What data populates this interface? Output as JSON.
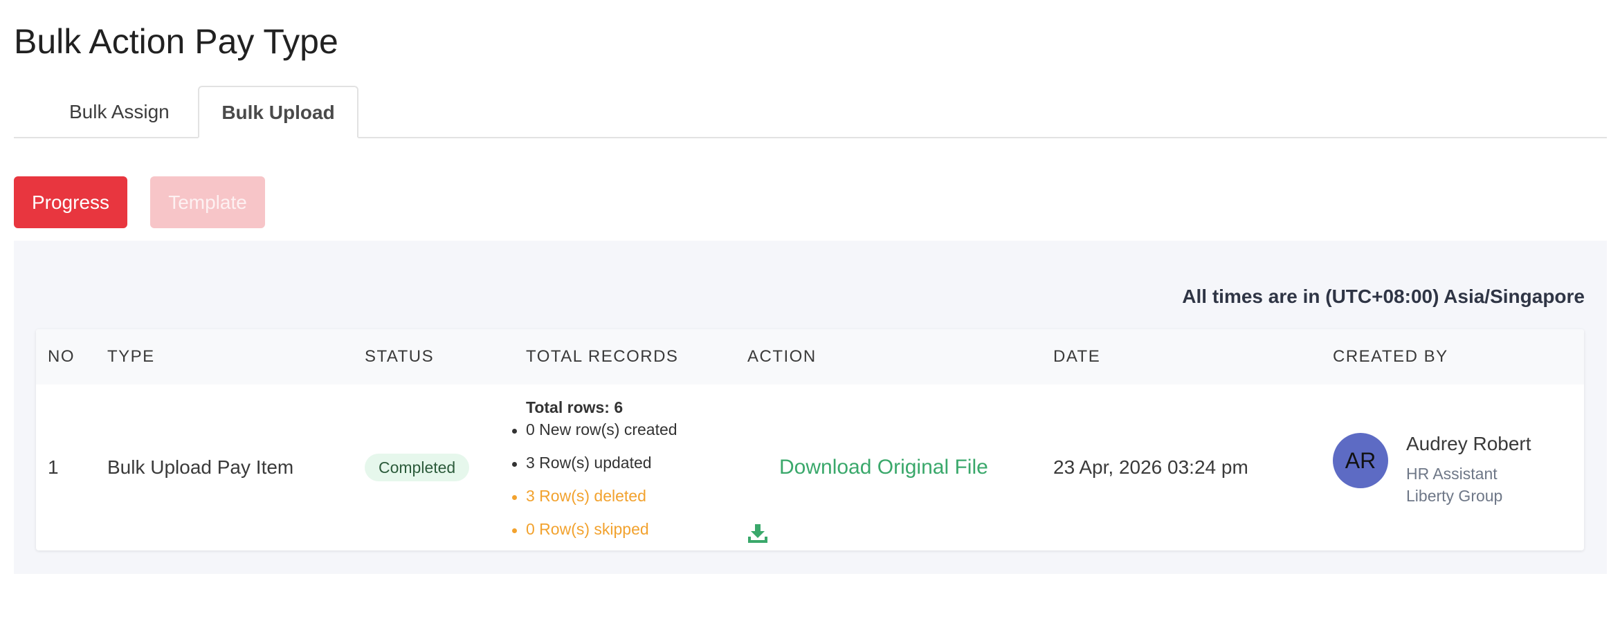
{
  "page": {
    "title": "Bulk Action Pay Type"
  },
  "tabs": [
    {
      "label": "Bulk Assign",
      "active": false
    },
    {
      "label": "Bulk Upload",
      "active": true
    }
  ],
  "toolbar": {
    "progress_label": "Progress",
    "template_label": "Template",
    "progress_color": "#e8363f",
    "template_color": "#f7c5c8"
  },
  "panel": {
    "timezone_note": "All times are in (UTC+08:00) Asia/Singapore"
  },
  "table": {
    "headers": {
      "no": "NO",
      "type": "TYPE",
      "status": "STATUS",
      "total_records": "TOTAL RECORDS",
      "action": "ACTION",
      "date": "DATE",
      "created_by": "CREATED BY"
    },
    "rows": [
      {
        "no": "1",
        "type": "Bulk Upload Pay Item",
        "status": "Completed",
        "records": {
          "total": "Total rows: 6",
          "created": "0 New row(s) created",
          "updated": "3 Row(s) updated",
          "deleted": "3 Row(s) deleted",
          "skipped": "0 Row(s) skipped"
        },
        "action_label": "Download Original File",
        "action_icon": "download-icon",
        "date": "23 Apr, 2026 03:24 pm",
        "creator": {
          "initials": "AR",
          "name": "Audrey Robert",
          "role": "HR Assistant",
          "org": "Liberty Group",
          "avatar_color": "#5d6bc4"
        }
      }
    ]
  },
  "colors": {
    "success_green": "#3aa86b",
    "warning_orange": "#f2a22e",
    "panel_bg": "#f5f6fa"
  }
}
